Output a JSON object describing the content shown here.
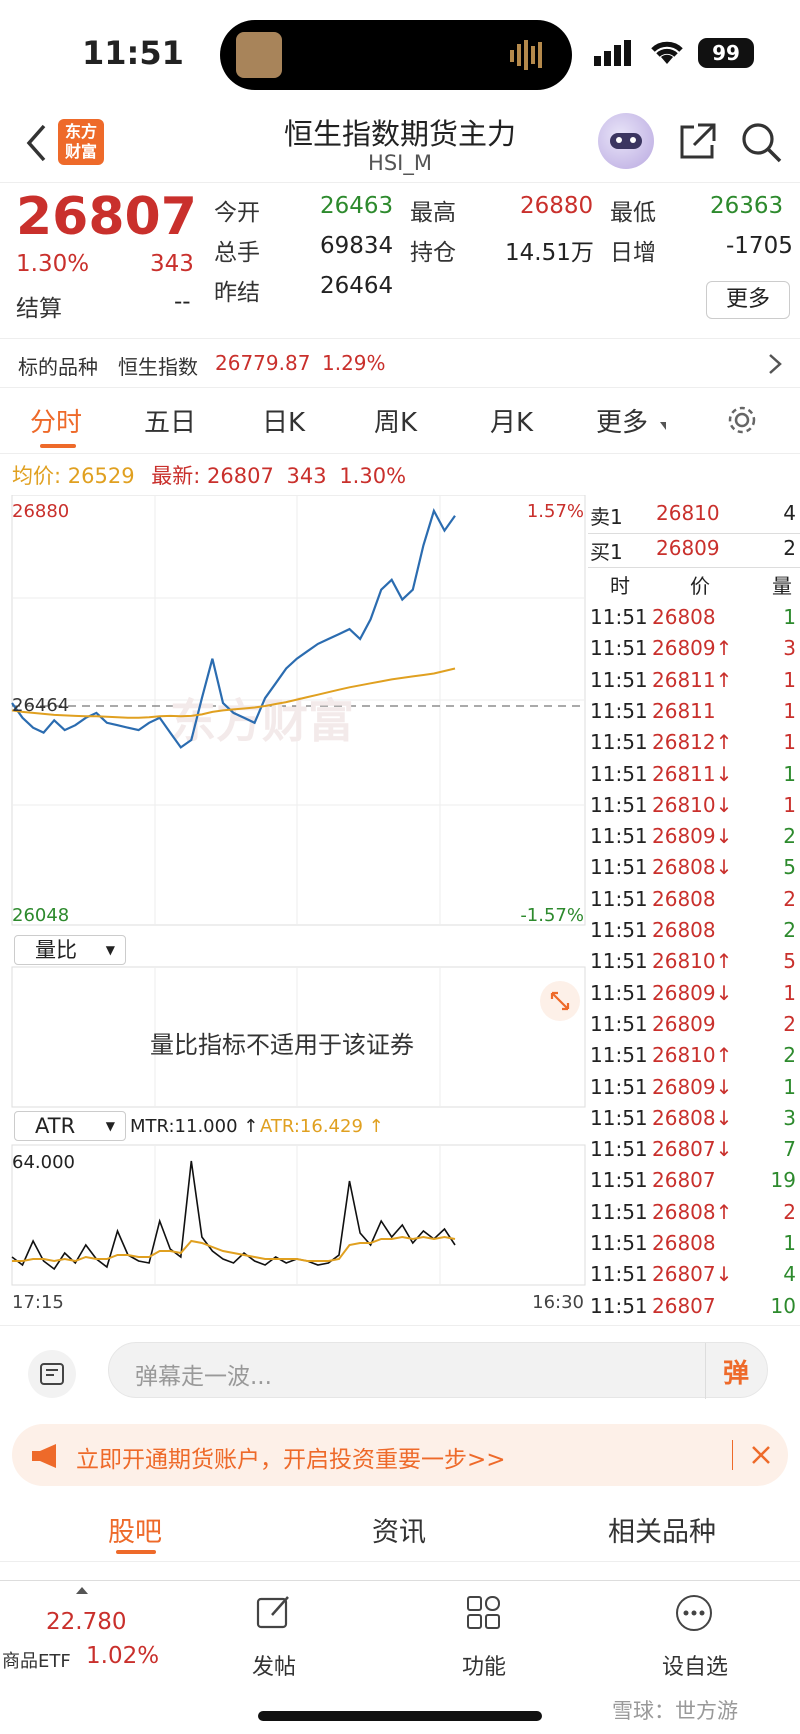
{
  "status_bar": {
    "time": "11:51",
    "battery": "99"
  },
  "header": {
    "logo_text": "东方财富",
    "title": "恒生指数期货主力",
    "subtitle": "HSI_M"
  },
  "quote": {
    "price": "26807",
    "change_pct": "1.30%",
    "change": "343",
    "fields": [
      {
        "label": "今开",
        "value": "26463",
        "color": "#2d8a2d"
      },
      {
        "label": "最高",
        "value": "26880",
        "color": "#c9302c"
      },
      {
        "label": "最低",
        "value": "26363",
        "color": "#2d8a2d"
      },
      {
        "label": "总手",
        "value": "69834",
        "color": "#222"
      },
      {
        "label": "持仓",
        "value": "14.51万",
        "color": "#222"
      },
      {
        "label": "日增",
        "value": "-1705",
        "color": "#222"
      },
      {
        "label": "结算",
        "value": "--",
        "color": "#222"
      },
      {
        "label": "昨结",
        "value": "26464",
        "color": "#222"
      }
    ],
    "more_button": "更多"
  },
  "underlying": {
    "label": "标的品种",
    "name": "恒生指数",
    "value": "26779.87",
    "pct": "1.29%"
  },
  "tabs": [
    "分时",
    "五日",
    "日K",
    "周K",
    "月K",
    "更多"
  ],
  "summary": {
    "avg_label": "均价:",
    "avg": "26529",
    "latest_label": "最新:",
    "latest": "26807",
    "change": "343",
    "pct": "1.30%"
  },
  "chart_data": [
    {
      "type": "line",
      "title": "",
      "y_high": "26880",
      "y_low": "26048",
      "y_ref": "26464",
      "pct_high": "1.57%",
      "pct_low": "-1.57%",
      "watermark": "东方财富",
      "series": [
        {
          "name": "",
          "color": "#2b6cb0",
          "values": [
            26470,
            26440,
            26420,
            26410,
            26435,
            26415,
            26425,
            26440,
            26450,
            26430,
            26425,
            26420,
            26415,
            26430,
            26440,
            26410,
            26380,
            26395,
            26480,
            26560,
            26470,
            26450,
            26440,
            26430,
            26480,
            26510,
            26540,
            26560,
            26575,
            26590,
            26600,
            26610,
            26620,
            26600,
            26640,
            26700,
            26720,
            26680,
            26700,
            26790,
            26860,
            26820,
            26850
          ]
        },
        {
          "name": "",
          "color": "#e0a020",
          "values": [
            26455,
            26452,
            26450,
            26448,
            26446,
            26445,
            26444,
            26443,
            26443,
            26442,
            26441,
            26440,
            26440,
            26441,
            26443,
            26444,
            26443,
            26444,
            26447,
            26452,
            26455,
            26457,
            26459,
            26461,
            26464,
            26468,
            26472,
            26477,
            26482,
            26487,
            26492,
            26497,
            26502,
            26506,
            26510,
            26514,
            26518,
            26521,
            26524,
            26527,
            26530,
            26535,
            26540
          ]
        }
      ]
    },
    {
      "type": "text",
      "indicator": "量比",
      "message": "量比指标不适用于该证券"
    },
    {
      "type": "line",
      "indicator": "ATR",
      "mtr_label": "MTR:11.000 ↑",
      "atr_label": "ATR:16.429 ↑",
      "y_top": "64.000",
      "x_start": "17:15",
      "x_end": "16:30",
      "series": [
        {
          "name": "MTR",
          "color": "#111",
          "values": [
            12,
            8,
            20,
            10,
            6,
            14,
            9,
            18,
            11,
            7,
            25,
            13,
            10,
            9,
            30,
            16,
            12,
            60,
            22,
            15,
            11,
            9,
            14,
            10,
            8,
            12,
            9,
            11,
            10,
            8,
            9,
            13,
            50,
            24,
            18,
            30,
            22,
            28,
            19,
            25,
            21,
            26,
            18
          ]
        },
        {
          "name": "ATR",
          "color": "#e0a020",
          "values": [
            10,
            10,
            11,
            11,
            10,
            11,
            10,
            12,
            11,
            11,
            13,
            13,
            12,
            12,
            15,
            15,
            14,
            20,
            19,
            17,
            15,
            14,
            13,
            12,
            11,
            11,
            11,
            11,
            10,
            10,
            10,
            11,
            18,
            19,
            19,
            21,
            21,
            22,
            21,
            22,
            21,
            22,
            21
          ]
        }
      ]
    }
  ],
  "ticks_header": {
    "sell_label": "卖1",
    "sell_price": "26810",
    "sell_qty": "4",
    "buy_label": "买1",
    "buy_price": "26809",
    "buy_qty": "2",
    "col_time": "时",
    "col_price": "价",
    "col_qty": "量"
  },
  "ticks": [
    {
      "time": "11:51",
      "price": "26808",
      "arrow": "",
      "qty": "1",
      "qc": "#2d8a2d"
    },
    {
      "time": "11:51",
      "price": "26809↑",
      "arrow": "",
      "qty": "3",
      "qc": "#c9302c"
    },
    {
      "time": "11:51",
      "price": "26811↑",
      "arrow": "",
      "qty": "1",
      "qc": "#c9302c"
    },
    {
      "time": "11:51",
      "price": "26811",
      "arrow": "",
      "qty": "1",
      "qc": "#c9302c"
    },
    {
      "time": "11:51",
      "price": "26812↑",
      "arrow": "",
      "qty": "1",
      "qc": "#c9302c"
    },
    {
      "time": "11:51",
      "price": "26811↓",
      "arrow": "",
      "qty": "1",
      "qc": "#2d8a2d"
    },
    {
      "time": "11:51",
      "price": "26810↓",
      "arrow": "",
      "qty": "1",
      "qc": "#c9302c"
    },
    {
      "time": "11:51",
      "price": "26809↓",
      "arrow": "",
      "qty": "2",
      "qc": "#2d8a2d"
    },
    {
      "time": "11:51",
      "price": "26808↓",
      "arrow": "",
      "qty": "5",
      "qc": "#2d8a2d"
    },
    {
      "time": "11:51",
      "price": "26808",
      "arrow": "",
      "qty": "2",
      "qc": "#c9302c"
    },
    {
      "time": "11:51",
      "price": "26808",
      "arrow": "",
      "qty": "2",
      "qc": "#2d8a2d"
    },
    {
      "time": "11:51",
      "price": "26810↑",
      "arrow": "",
      "qty": "5",
      "qc": "#c9302c"
    },
    {
      "time": "11:51",
      "price": "26809↓",
      "arrow": "",
      "qty": "1",
      "qc": "#c9302c"
    },
    {
      "time": "11:51",
      "price": "26809",
      "arrow": "",
      "qty": "2",
      "qc": "#c9302c"
    },
    {
      "time": "11:51",
      "price": "26810↑",
      "arrow": "",
      "qty": "2",
      "qc": "#2d8a2d"
    },
    {
      "time": "11:51",
      "price": "26809↓",
      "arrow": "",
      "qty": "1",
      "qc": "#2d8a2d"
    },
    {
      "time": "11:51",
      "price": "26808↓",
      "arrow": "",
      "qty": "3",
      "qc": "#2d8a2d"
    },
    {
      "time": "11:51",
      "price": "26807↓",
      "arrow": "",
      "qty": "7",
      "qc": "#2d8a2d"
    },
    {
      "time": "11:51",
      "price": "26807",
      "arrow": "",
      "qty": "19",
      "qc": "#2d8a2d"
    },
    {
      "time": "11:51",
      "price": "26808↑",
      "arrow": "",
      "qty": "2",
      "qc": "#c9302c"
    },
    {
      "time": "11:51",
      "price": "26808",
      "arrow": "",
      "qty": "1",
      "qc": "#2d8a2d"
    },
    {
      "time": "11:51",
      "price": "26807↓",
      "arrow": "",
      "qty": "4",
      "qc": "#2d8a2d"
    },
    {
      "time": "11:51",
      "price": "26807",
      "arrow": "",
      "qty": "10",
      "qc": "#2d8a2d"
    }
  ],
  "danmu": {
    "placeholder": "弹幕走一波...",
    "send_label": "弹"
  },
  "banner": {
    "text": "立即开通期货账户，开启投资重要一步>>"
  },
  "subtabs": [
    "股吧",
    "资讯",
    "相关品种"
  ],
  "bottom": {
    "etf_price": "22.780",
    "etf_label": "商品ETF",
    "etf_pct": "1.02%",
    "post": "发帖",
    "func": "功能",
    "watch": "设自选",
    "watermark": "雪球：世方游"
  }
}
